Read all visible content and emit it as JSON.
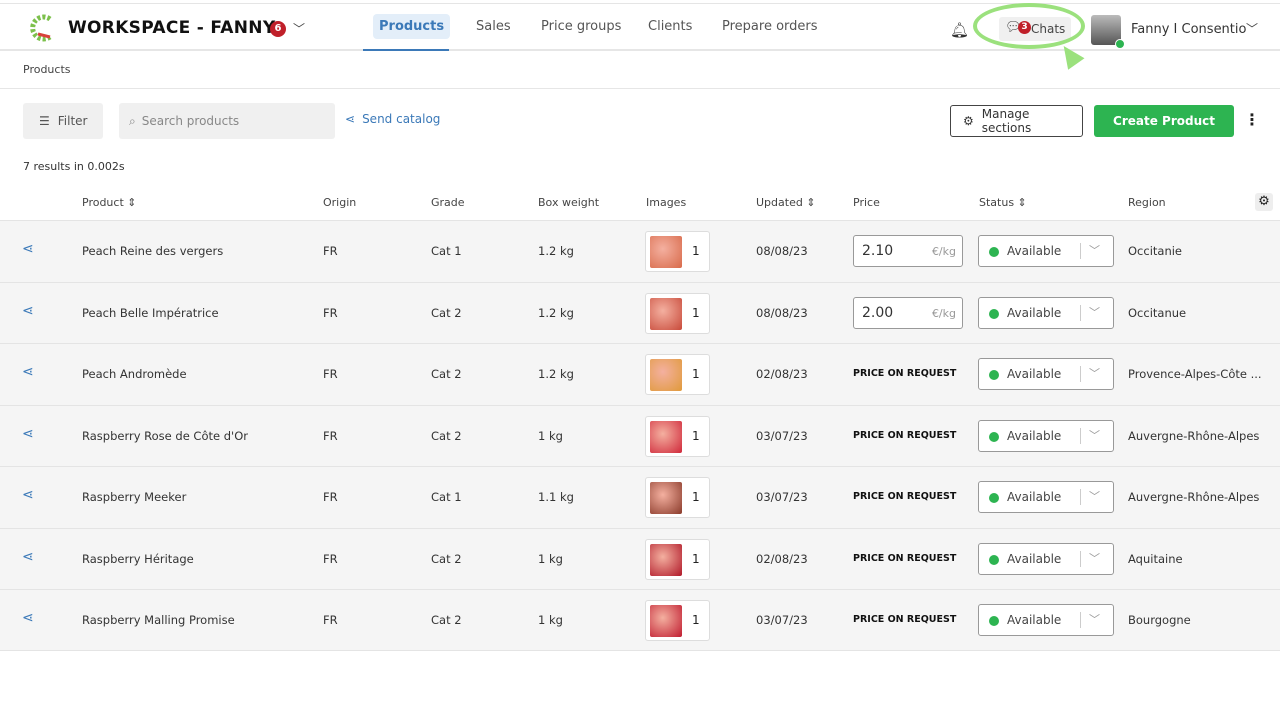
{
  "header": {
    "workspace": "WORKSPACE - FANNY",
    "workspace_badge": "6",
    "nav": [
      "Products",
      "Sales",
      "Price groups",
      "Clients",
      "Prepare orders"
    ],
    "chats_label": "Chats",
    "chats_badge": "3",
    "user": "Fanny I Consentio"
  },
  "breadcrumb": "Products",
  "toolbar": {
    "filter": "Filter",
    "search_placeholder": "Search products",
    "send_catalog": "Send catalog",
    "manage_sections": "Manage sections",
    "create_product": "Create Product"
  },
  "results": "7 results in 0.002s",
  "columns": [
    "Product",
    "Origin",
    "Grade",
    "Box weight",
    "Images",
    "Updated",
    "Price",
    "Status",
    "Region"
  ],
  "colors": {
    "accent": "#3b79b8",
    "green": "#2db451",
    "badge": "#c0202a"
  },
  "rows": [
    {
      "product": "Peach Reine des vergers",
      "origin": "FR",
      "grade": "Cat 1",
      "weight": "1.2 kg",
      "images": "1",
      "updated": "08/08/23",
      "price": "2.10",
      "unit": "€/kg",
      "status": "Available",
      "region": "Occitanie",
      "thumb": "#d86a4a"
    },
    {
      "product": "Peach Belle Impératrice",
      "origin": "FR",
      "grade": "Cat 2",
      "weight": "1.2 kg",
      "images": "1",
      "updated": "08/08/23",
      "price": "2.00",
      "unit": "€/kg",
      "status": "Available",
      "region": "Occitanue",
      "thumb": "#c84a3a"
    },
    {
      "product": "Peach Andromède",
      "origin": "FR",
      "grade": "Cat 2",
      "weight": "1.2 kg",
      "images": "1",
      "updated": "02/08/23",
      "price_text": "PRICE ON REQUEST",
      "status": "Available",
      "region": "Provence-Alpes-Côte ...",
      "thumb": "#e09a3a"
    },
    {
      "product": "Raspberry Rose de Côte d'Or",
      "origin": "FR",
      "grade": "Cat 2",
      "weight": "1 kg",
      "images": "1",
      "updated": "03/07/23",
      "price_text": "PRICE ON REQUEST",
      "status": "Available",
      "region": "Auvergne-Rhône-Alpes",
      "thumb": "#d0283a"
    },
    {
      "product": "Raspberry Meeker",
      "origin": "FR",
      "grade": "Cat 1",
      "weight": "1.1 kg",
      "images": "1",
      "updated": "03/07/23",
      "price_text": "PRICE ON REQUEST",
      "status": "Available",
      "region": "Auvergne-Rhône-Alpes",
      "thumb": "#8a3a2a"
    },
    {
      "product": "Raspberry Héritage",
      "origin": "FR",
      "grade": "Cat 2",
      "weight": "1 kg",
      "images": "1",
      "updated": "02/08/23",
      "price_text": "PRICE ON REQUEST",
      "status": "Available",
      "region": "Aquitaine",
      "thumb": "#b01828"
    },
    {
      "product": "Raspberry Malling Promise",
      "origin": "FR",
      "grade": "Cat 2",
      "weight": "1 kg",
      "images": "1",
      "updated": "03/07/23",
      "price_text": "PRICE ON REQUEST",
      "status": "Available",
      "region": "Bourgogne",
      "thumb": "#c01c30"
    }
  ]
}
